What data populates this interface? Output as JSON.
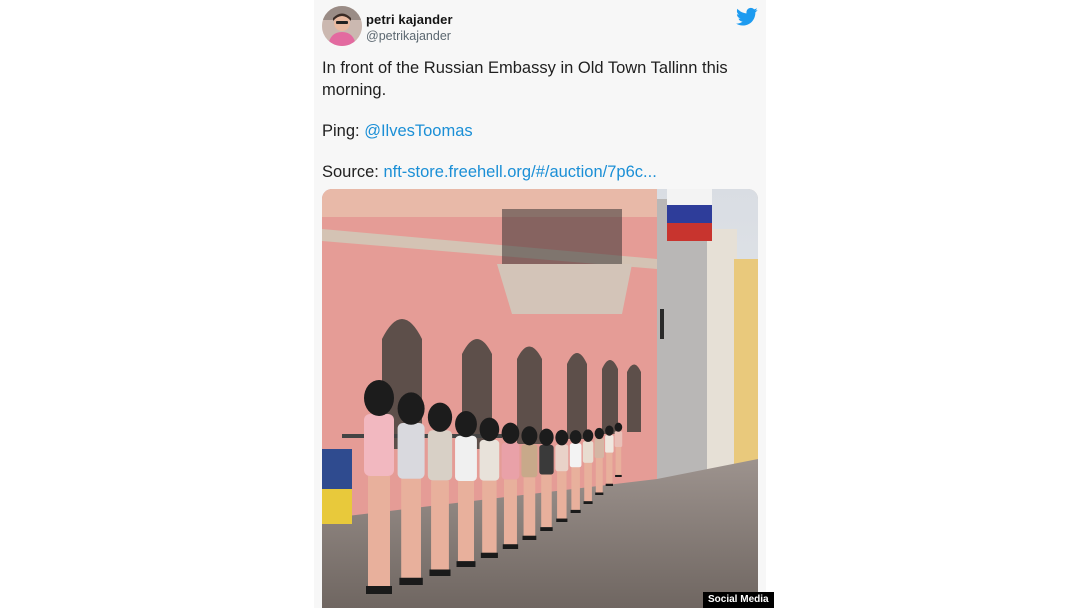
{
  "tweet": {
    "author_name": "petri kajander",
    "author_handle": "@petrikajander",
    "line1": "In front of the Russian Embassy in Old Town Tallinn this morning.",
    "ping_label": "Ping: ",
    "ping_mention": "@IlvesToomas",
    "source_label": "Source: ",
    "source_link": "nft-store.freehell.org/#/auction/7p6c...",
    "icons": {
      "brand": "twitter-bird-icon"
    },
    "colors": {
      "link": "#1b8fd6",
      "twitter_blue": "#1d9bf0"
    }
  },
  "photo_credit": "Social Media"
}
